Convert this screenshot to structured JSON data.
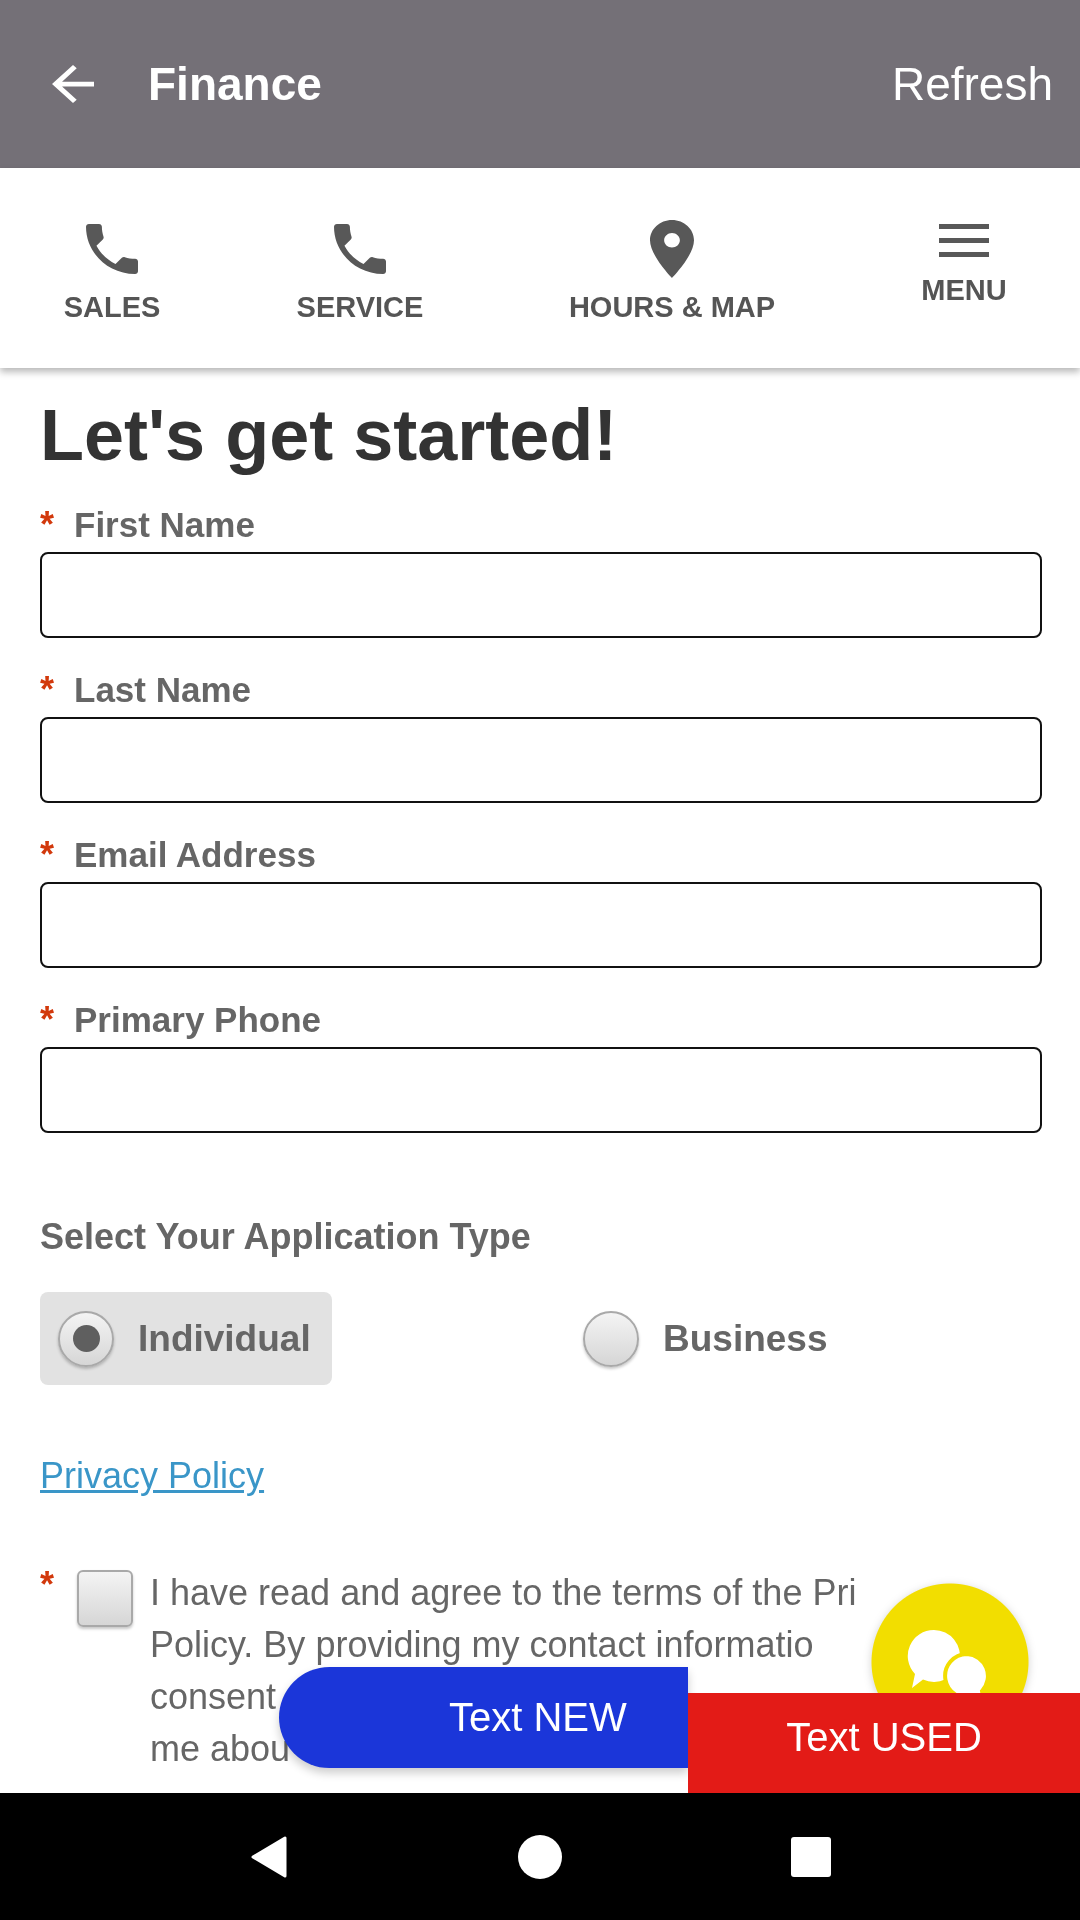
{
  "app_bar": {
    "title": "Finance",
    "action": "Refresh"
  },
  "quick_nav": [
    {
      "kind": "phone",
      "label": "SALES"
    },
    {
      "kind": "phone",
      "label": "SERVICE"
    },
    {
      "kind": "pin",
      "label": "HOURS & MAP"
    },
    {
      "kind": "menu",
      "label": "MENU"
    }
  ],
  "form": {
    "heading": "Let's get started!",
    "fields": [
      {
        "label": "First Name",
        "required_mark": "*"
      },
      {
        "label": "Last Name",
        "required_mark": "*"
      },
      {
        "label": "Email Address",
        "required_mark": "*"
      },
      {
        "label": "Primary Phone",
        "required_mark": "*"
      }
    ],
    "application_type": {
      "label": "Select Your Application Type",
      "options": [
        {
          "label": "Individual",
          "selected": true
        },
        {
          "label": "Business",
          "selected": false
        }
      ]
    },
    "privacy_link": "Privacy Policy",
    "consent": {
      "required_mark": "*",
      "checked": false,
      "text_lines": [
        "I have read and agree to the terms of the Pri",
        "Policy. By providing my contact informatio",
        "consent",
        "me abou"
      ]
    }
  },
  "floating_buttons": [
    {
      "kind": "pill",
      "label": "Text NEW"
    },
    {
      "kind": "bar",
      "label": "Text USED"
    }
  ]
}
